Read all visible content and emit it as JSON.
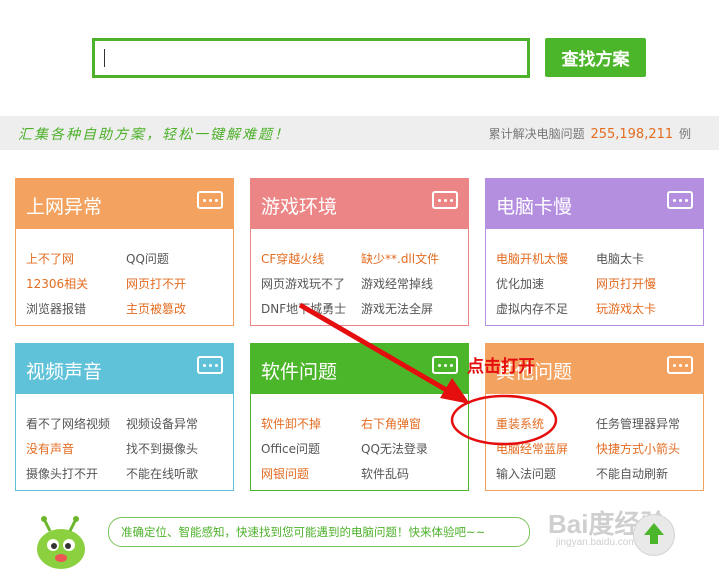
{
  "search": {
    "value": "",
    "button_label": "查找方案"
  },
  "banner": {
    "slogan": "汇集各种自助方案，轻松一键解难题！",
    "counter_prefix": "累计解决电脑问题",
    "counter_value": "255,198,211",
    "counter_suffix": "例"
  },
  "categories": [
    {
      "title": "上网异常",
      "color": "#f3a25f",
      "links": [
        [
          "上不了网",
          "QQ问题"
        ],
        [
          "12306相关",
          "网页打不开"
        ],
        [
          "浏览器报错",
          "主页被篡改"
        ]
      ],
      "highlight": [
        [
          true,
          false
        ],
        [
          true,
          true
        ],
        [
          false,
          true
        ]
      ]
    },
    {
      "title": "游戏环境",
      "color": "#ec8686",
      "links": [
        [
          "CF穿越火线",
          "缺少**.dll文件"
        ],
        [
          "网页游戏玩不了",
          "游戏经常掉线"
        ],
        [
          "DNF地下城勇士",
          "游戏无法全屏"
        ]
      ],
      "highlight": [
        [
          true,
          true
        ],
        [
          false,
          false
        ],
        [
          false,
          false
        ]
      ]
    },
    {
      "title": "电脑卡慢",
      "color": "#b48fe0",
      "links": [
        [
          "电脑开机太慢",
          "电脑太卡"
        ],
        [
          "优化加速",
          "网页打开慢"
        ],
        [
          "虚拟内存不足",
          "玩游戏太卡"
        ]
      ],
      "highlight": [
        [
          true,
          false
        ],
        [
          false,
          true
        ],
        [
          false,
          true
        ]
      ]
    },
    {
      "title": "视频声音",
      "color": "#5fc2d9",
      "links": [
        [
          "看不了网络视频",
          "视频设备异常"
        ],
        [
          "没有声音",
          "找不到摄像头"
        ],
        [
          "摄像头打不开",
          "不能在线听歌"
        ]
      ],
      "highlight": [
        [
          false,
          false
        ],
        [
          true,
          false
        ],
        [
          false,
          false
        ]
      ]
    },
    {
      "title": "软件问题",
      "color": "#4cb62a",
      "links": [
        [
          "软件卸不掉",
          "右下角弹窗"
        ],
        [
          "Office问题",
          "QQ无法登录"
        ],
        [
          "网银问题",
          "软件乱码"
        ]
      ],
      "highlight": [
        [
          true,
          true
        ],
        [
          false,
          false
        ],
        [
          true,
          false
        ]
      ]
    },
    {
      "title": "其他问题",
      "color": "#f3a25f",
      "links": [
        [
          "重装系统",
          "任务管理器异常"
        ],
        [
          "电脑经常蓝屏",
          "快捷方式小箭头"
        ],
        [
          "输入法问题",
          "不能自动刷新"
        ]
      ],
      "highlight": [
        [
          true,
          false
        ],
        [
          true,
          true
        ],
        [
          false,
          false
        ]
      ]
    }
  ],
  "annotation": {
    "label": "点击打开",
    "color": "#e50e0e"
  },
  "footer": {
    "bubble_text": "准确定位、智能感知，快速找到您可能遇到的电脑问题！快来体验吧~~",
    "watermark": "Bai度经验",
    "watermark_sub": "jingyan.baidu.com"
  },
  "icons": {
    "more": "more-dots-icon",
    "back_to_top": "up-arrow-icon",
    "mascot": "green-mascot-icon"
  }
}
